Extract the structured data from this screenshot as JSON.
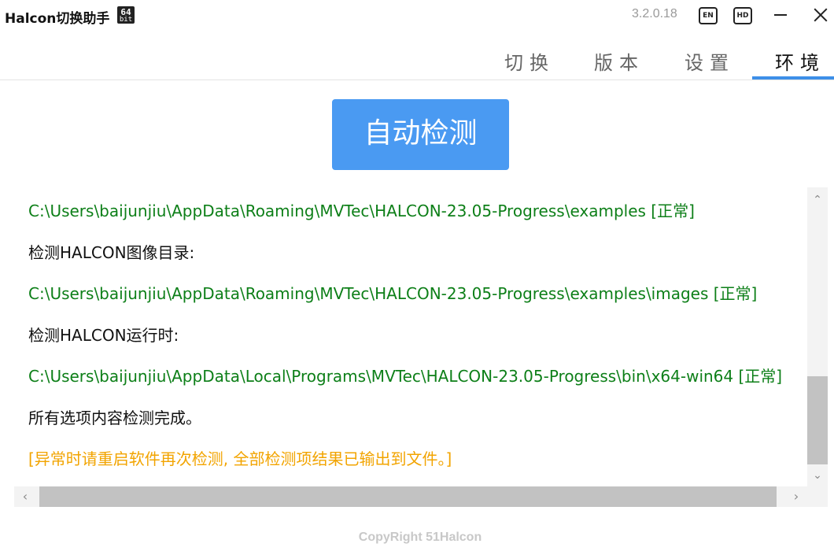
{
  "window": {
    "title": "Halcon切换助手",
    "bit_badge_top": "64",
    "bit_badge_bottom": "bit",
    "version": "3.2.0.18",
    "lang_button": "EN",
    "hd_button": "HD"
  },
  "tabs": [
    {
      "label": "切换",
      "active": false
    },
    {
      "label": "版本",
      "active": false
    },
    {
      "label": "设置",
      "active": false
    },
    {
      "label": "环境",
      "active": true
    }
  ],
  "main": {
    "detect_button": "自动检测",
    "log_lines": [
      {
        "text": "C:\\Users\\baijunjiu\\AppData\\Roaming\\MVTec\\HALCON-23.05-Progress\\examples [正常]",
        "status": "ok"
      },
      {
        "text": "检测HALCON图像目录:",
        "status": "heading"
      },
      {
        "text": "C:\\Users\\baijunjiu\\AppData\\Roaming\\MVTec\\HALCON-23.05-Progress\\examples\\images [正常]",
        "status": "ok"
      },
      {
        "text": "检测HALCON运行时:",
        "status": "heading"
      },
      {
        "text": "C:\\Users\\baijunjiu\\AppData\\Local\\Programs\\MVTec\\HALCON-23.05-Progress\\bin\\x64-win64 [正常]",
        "status": "ok"
      },
      {
        "text": "所有选项内容检测完成。",
        "status": "heading"
      },
      {
        "text": "[异常时请重启软件再次检测, 全部检测项结果已输出到文件。]",
        "status": "warning"
      }
    ]
  },
  "footer": {
    "copyright": "CopyRight 51Halcon"
  },
  "colors": {
    "accent": "#4a9af2",
    "ok": "#0d7f18",
    "warning": "#f2a400"
  }
}
